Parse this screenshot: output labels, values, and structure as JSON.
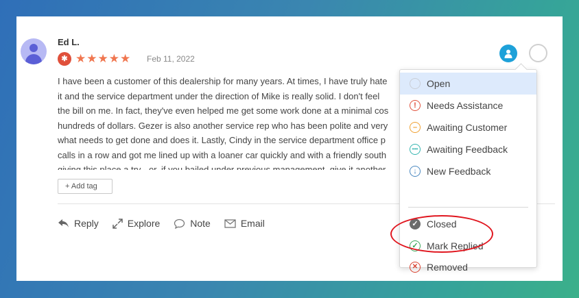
{
  "review": {
    "author": "Ed L.",
    "source_icon": "yelp-icon",
    "rating": 5,
    "stars_text": "★★★★★",
    "date": "Feb 11, 2022",
    "lines": [
      "I have been a customer of this dealership for many years. At times, I have truly hate",
      "it and the service department under the direction of Mike is really solid. I don't feel",
      "the bill on me. In fact, they've even helped me get some work done at a minimal cos",
      "hundreds of dollars. Gezer is also another service rep who has been polite and very",
      "what needs to get done and does it. Lastly, Cindy in the service department office p",
      "calls in a row and got me lined up with a loaner car quickly and with a friendly south",
      "giving this place a try - or, if you bailed under previous management, give it another"
    ],
    "add_tag_label": "+ Add tag"
  },
  "actions": {
    "reply": "Reply",
    "explore": "Explore",
    "note": "Note",
    "email": "Email"
  },
  "status_menu": {
    "items": [
      {
        "label": "Open",
        "icon": "open-circle-icon",
        "color": "#c9ced6",
        "selected": true
      },
      {
        "label": "Needs Assistance",
        "icon": "exclamation-icon",
        "color": "#e0503b"
      },
      {
        "label": "Awaiting Customer",
        "icon": "minus-icon",
        "color": "#f0a030"
      },
      {
        "label": "Awaiting Feedback",
        "icon": "ellipsis-icon",
        "color": "#35b5b0"
      },
      {
        "label": "New Feedback",
        "icon": "arrow-down-icon",
        "color": "#4a88c0"
      }
    ],
    "closed_items": [
      {
        "label": "Closed",
        "icon": "check-filled-icon",
        "color": "#6b6b6b"
      },
      {
        "label": "Mark Replied",
        "icon": "check-circle-icon",
        "color": "#3aa65a"
      },
      {
        "label": "Removed",
        "icon": "x-circle-icon",
        "color": "#d9412f"
      }
    ]
  },
  "colors": {
    "accent": "#1ea1d9",
    "star": "#f0764f",
    "highlight": "#e0161f"
  }
}
